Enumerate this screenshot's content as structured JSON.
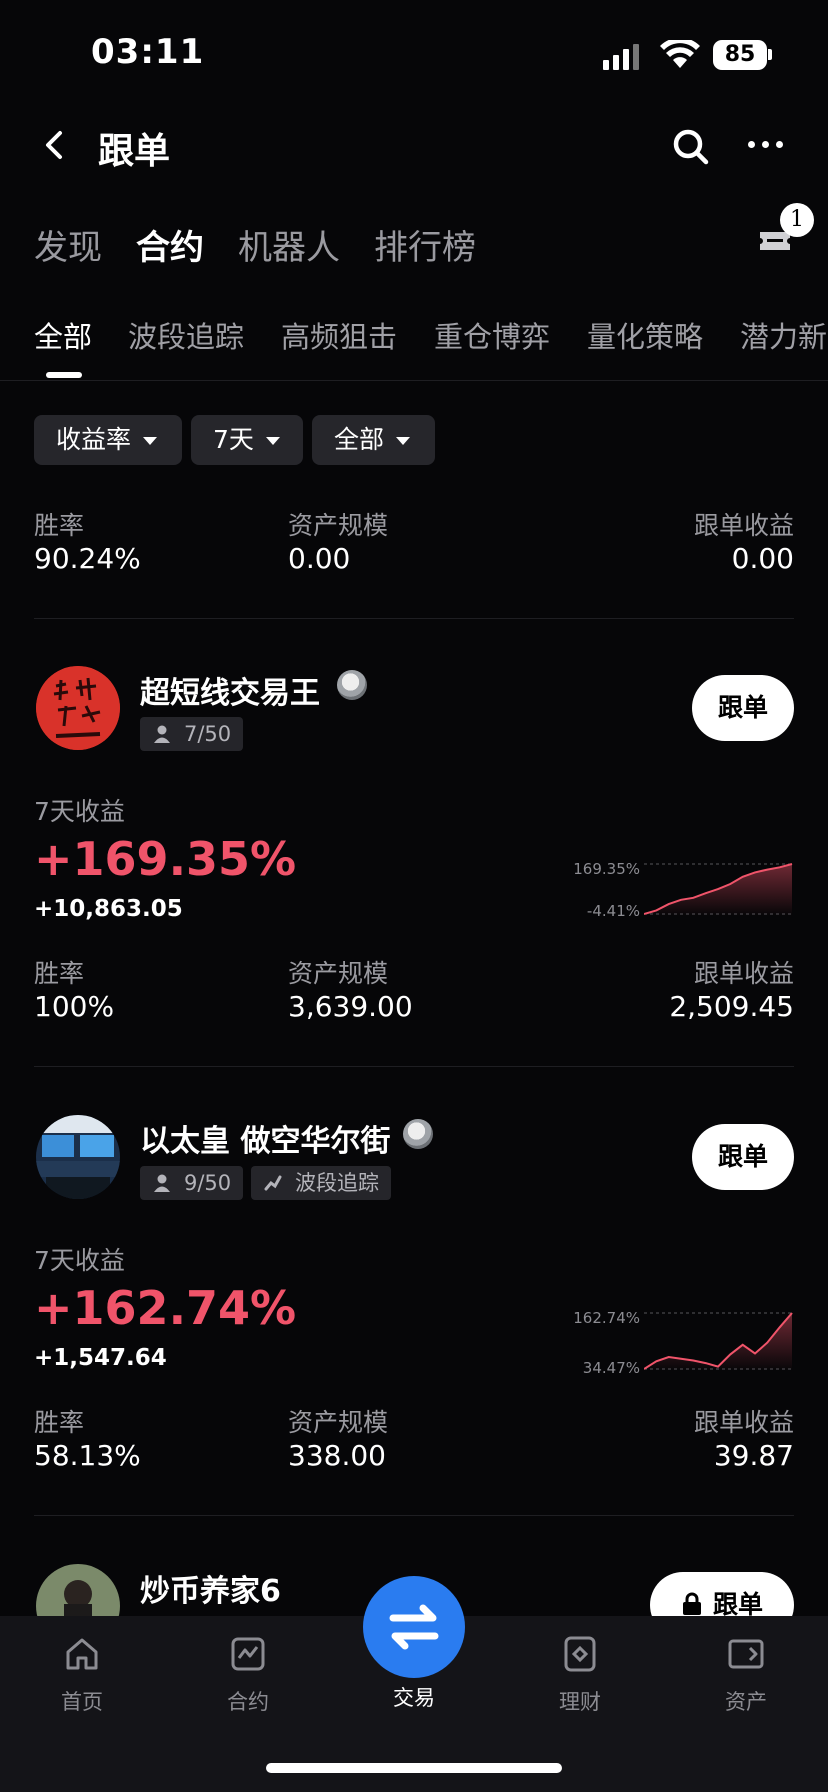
{
  "status_bar": {
    "time": "03:11",
    "battery": "85"
  },
  "header": {
    "title": "跟单"
  },
  "main_tabs": [
    {
      "label": "发现",
      "active": false
    },
    {
      "label": "合约",
      "active": true
    },
    {
      "label": "机器人",
      "active": false
    },
    {
      "label": "排行榜",
      "active": false
    }
  ],
  "ticket_badge": "1",
  "sub_tabs": [
    {
      "label": "全部",
      "active": true
    },
    {
      "label": "波段追踪",
      "active": false
    },
    {
      "label": "高频狙击",
      "active": false
    },
    {
      "label": "重仓博弈",
      "active": false
    },
    {
      "label": "量化策略",
      "active": false
    },
    {
      "label": "潜力新",
      "active": false
    }
  ],
  "filters": [
    "收益率",
    "7天",
    "全部"
  ],
  "summary": {
    "win_rate_label": "胜率",
    "win_rate": "90.24%",
    "aum_label": "资产规模",
    "aum": "0.00",
    "copy_profit_label": "跟单收益",
    "copy_profit": "0.00"
  },
  "traders": [
    {
      "name": "超短线交易王",
      "followers": "7/50",
      "style_tag": "",
      "follow_label": "跟单",
      "period_label": "7天收益",
      "roi": "+169.35%",
      "pnl": "+10,863.05",
      "spark_high": "169.35%",
      "spark_low": "-4.41%",
      "spark_values": [
        -4.41,
        8,
        30,
        45,
        52,
        68,
        82,
        100,
        125,
        140,
        150,
        158,
        169.35
      ],
      "win_rate_label": "胜率",
      "win_rate": "100%",
      "aum_label": "资产规模",
      "aum": "3,639.00",
      "copy_profit_label": "跟单收益",
      "copy_profit": "2,509.45"
    },
    {
      "name": "以太皇 做空华尔街",
      "followers": "9/50",
      "style_tag": "波段追踪",
      "follow_label": "跟单",
      "period_label": "7天收益",
      "roi": "+162.74%",
      "pnl": "+1,547.64",
      "spark_high": "162.74%",
      "spark_low": "34.47%",
      "spark_values": [
        34.47,
        52,
        62,
        58,
        54,
        48,
        40,
        68,
        90,
        70,
        95,
        130,
        162.74
      ],
      "win_rate_label": "胜率",
      "win_rate": "58.13%",
      "aum_label": "资产规模",
      "aum": "338.00",
      "copy_profit_label": "跟单收益",
      "copy_profit": "39.87"
    },
    {
      "name": "炒币养家6",
      "follow_label": "跟单"
    }
  ],
  "bottom_nav": [
    {
      "label": "首页",
      "icon": "home-icon",
      "active": false
    },
    {
      "label": "合约",
      "icon": "chart-icon",
      "active": false
    },
    {
      "label": "交易",
      "icon": "swap-icon",
      "active": true
    },
    {
      "label": "理财",
      "icon": "wealth-icon",
      "active": false
    },
    {
      "label": "资产",
      "icon": "wallet-icon",
      "active": false
    }
  ],
  "colors": {
    "positive": "#f0546a",
    "accent": "#2a7cf0",
    "background": "#060608"
  }
}
